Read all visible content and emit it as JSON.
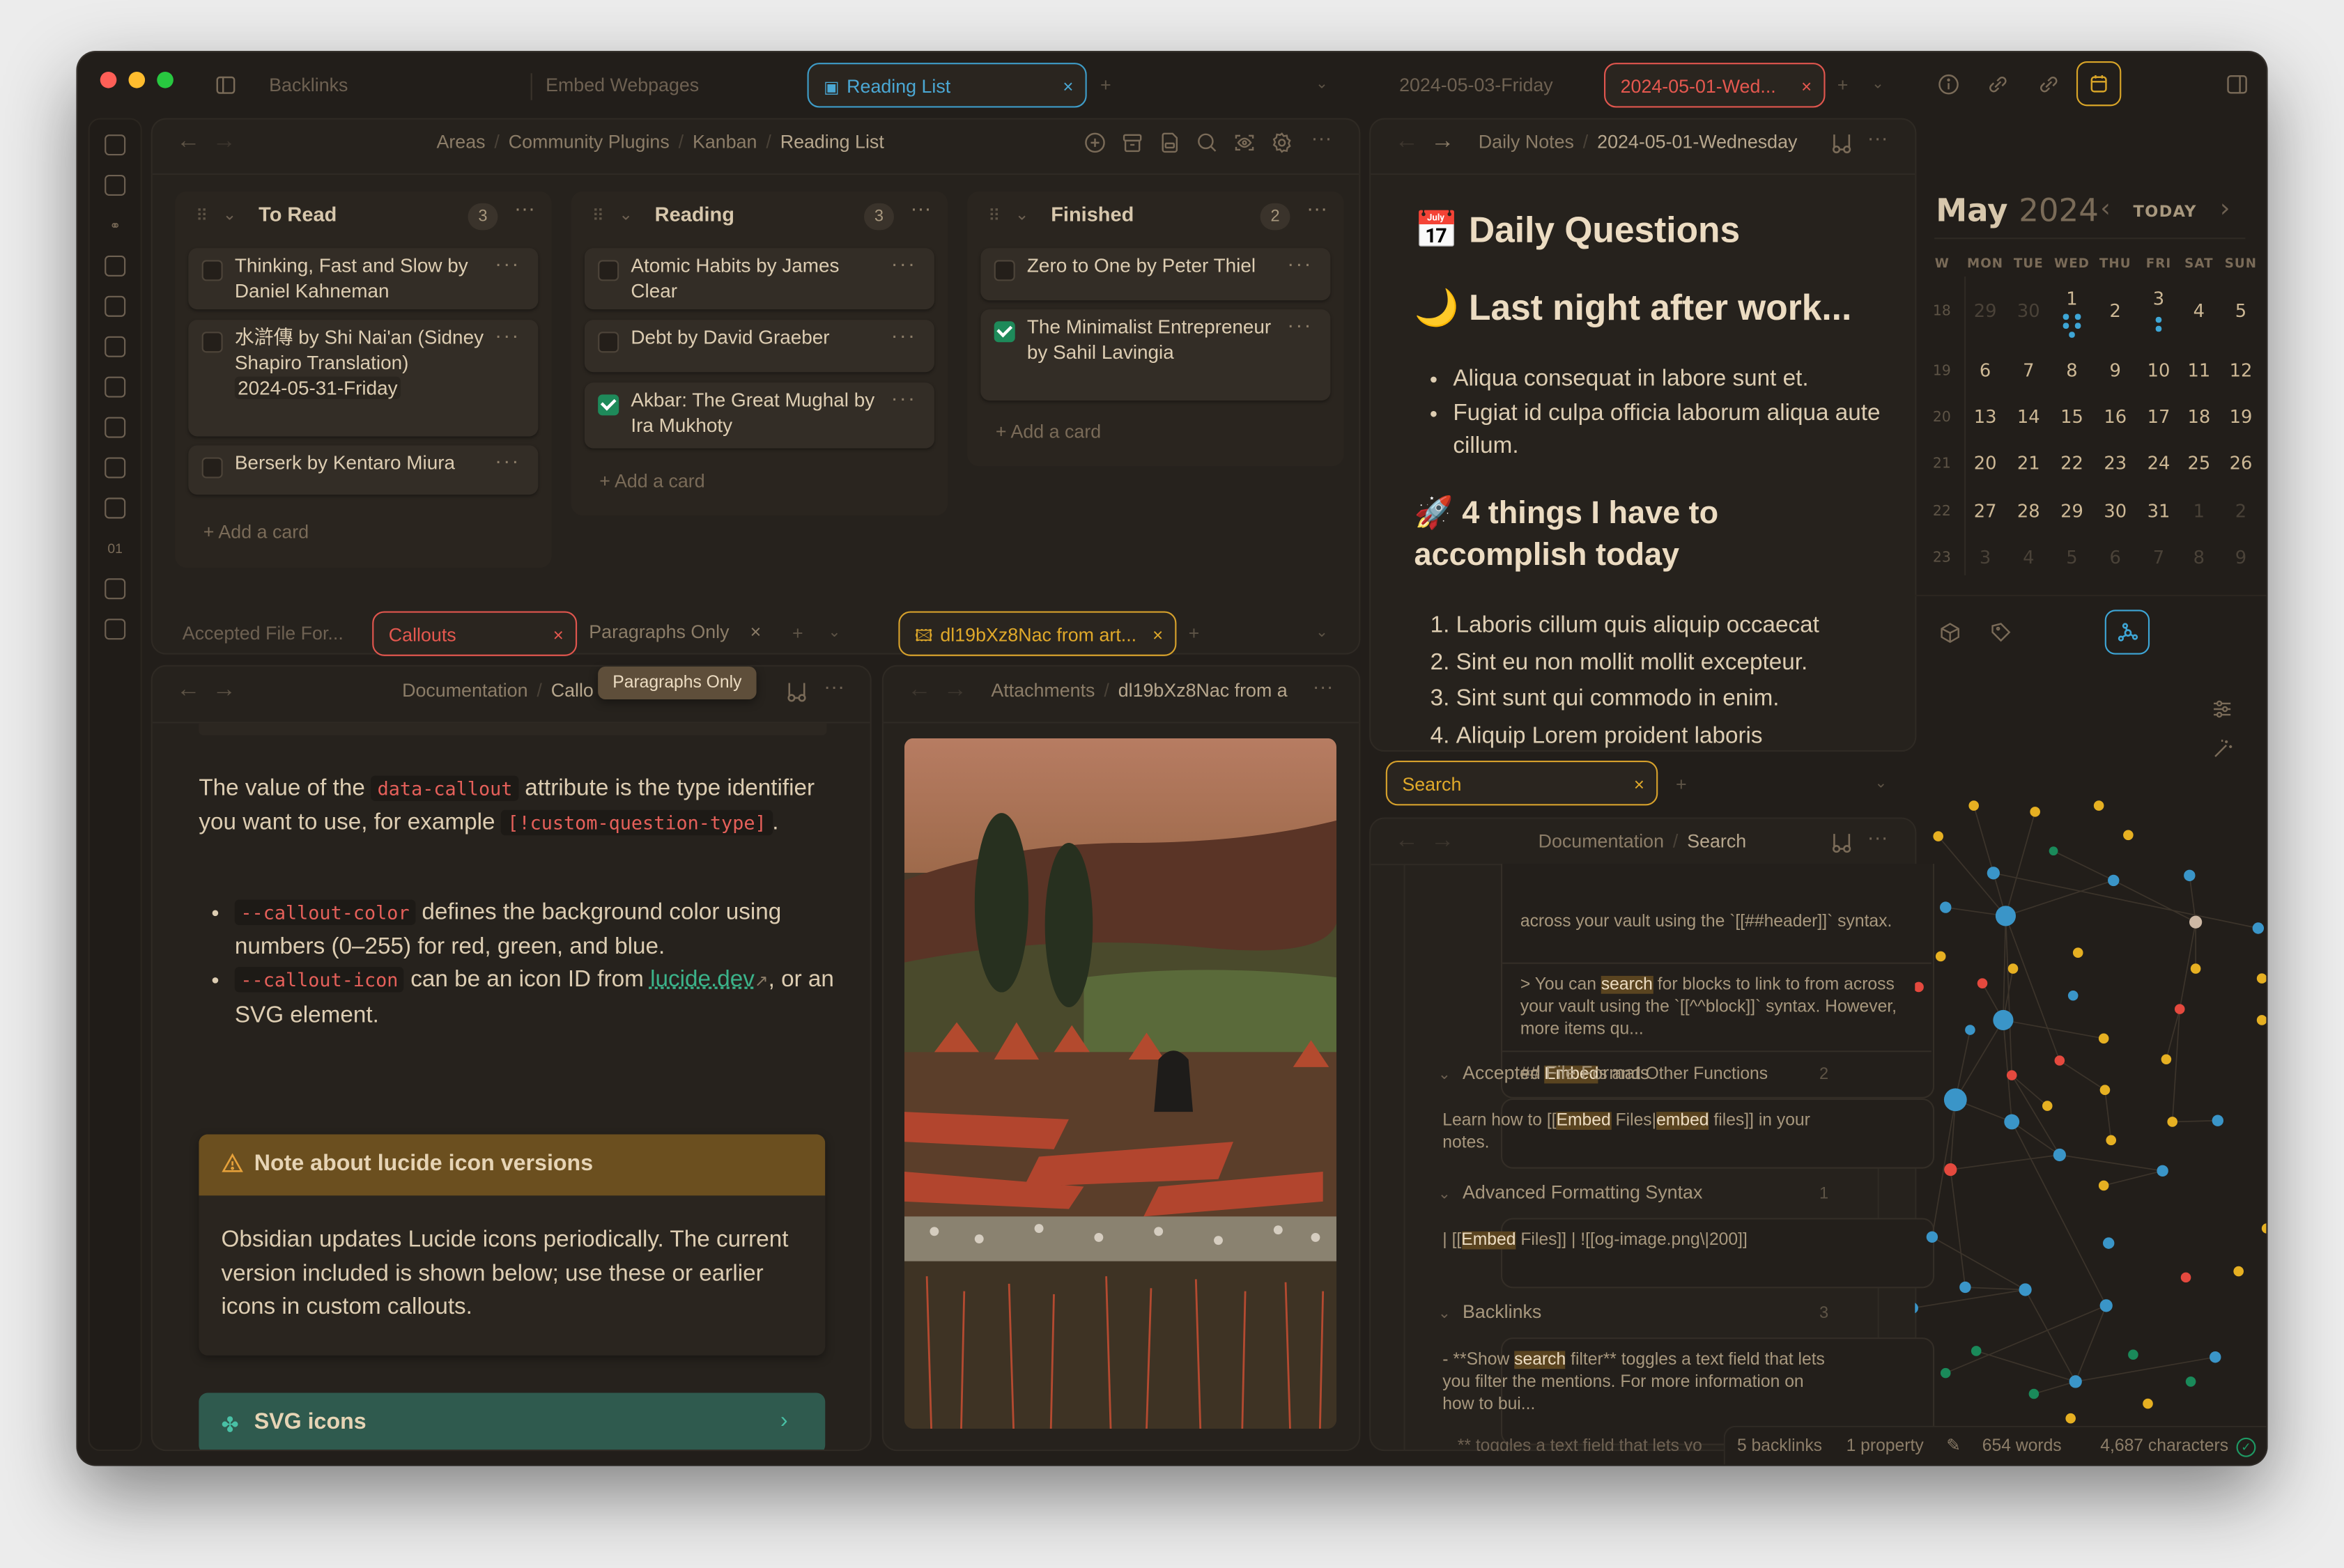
{
  "titlebar": {
    "tabs_left": [
      "Backlinks",
      "Embed Webpages",
      "Reading List"
    ],
    "active_tab_left": "Reading List",
    "tabs_right": [
      "2024-05-03-Friday",
      "2024-05-01-Wed..."
    ],
    "active_tab_right": "2024-05-01-Wed..."
  },
  "kanban": {
    "breadcrumb": [
      "Areas",
      "Community Plugins",
      "Kanban",
      "Reading List"
    ],
    "add_card_label": "+ Add a card",
    "columns": [
      {
        "title": "To Read",
        "count": "3",
        "cards": [
          {
            "text": "Thinking, Fast and Slow by Daniel Kahneman",
            "checked": false
          },
          {
            "text": "水滸傳 by Shi Nai'an (Sidney Shapiro Translation)",
            "date": "2024-05-31-Friday",
            "checked": false
          },
          {
            "text": "Berserk by Kentaro Miura",
            "checked": false
          }
        ]
      },
      {
        "title": "Reading",
        "count": "3",
        "cards": [
          {
            "text": "Atomic Habits by James Clear",
            "checked": false
          },
          {
            "text": "Debt by David Graeber",
            "checked": false
          },
          {
            "text": "Akbar: The Great Mughal by Ira Mukhoty",
            "checked": true
          }
        ]
      },
      {
        "title": "Finished",
        "count": "2",
        "cards": [
          {
            "text": "Zero to One by Peter Thiel",
            "checked": false
          },
          {
            "text": "The Minimalist Entrepreneur by Sahil Lavingia",
            "checked": true
          }
        ]
      }
    ]
  },
  "callouts_pane": {
    "tabs": [
      "Accepted File For...",
      "Callouts",
      "Paragraphs Only"
    ],
    "active_tab": "Callouts",
    "tooltip": "Paragraphs Only",
    "breadcrumb": [
      "Documentation",
      "Callo"
    ],
    "para": {
      "t1": "The value of the ",
      "code1": "data-callout",
      "t2": " attribute is the type identifier you want to use, for example ",
      "code2": "[!custom-question-type]",
      "t3": "."
    },
    "bullets": [
      {
        "code": "--callout-color",
        "text": " defines the background color using numbers (0–255) for red, green, and blue."
      },
      {
        "code": "--callout-icon",
        "text": " can be an icon ID from ",
        "link": "lucide.dev",
        "text2": ", or an SVG element."
      }
    ],
    "warning": {
      "title": "Note about lucide icon versions",
      "body": "Obsidian updates Lucide icons periodically. The current version included is shown below; use these or earlier icons in custom callouts.",
      "color": "#6b4f1f"
    },
    "svg_callout": {
      "title": "SVG icons",
      "color": "#2f5a4e"
    }
  },
  "image_pane": {
    "tab": "dl19bXz8Nac from art...",
    "breadcrumb": [
      "Attachments",
      "dl19bXz8Nac from a"
    ]
  },
  "daily_note": {
    "breadcrumb": [
      "Daily Notes",
      "2024-05-01-Wednesday"
    ],
    "h_daily": "Daily Questions",
    "h_last_night": "Last night after work...",
    "bullets": [
      "Aliqua consequat in labore sunt et.",
      "Fugiat id culpa officia laborum aliqua aute cillum."
    ],
    "h_things": "4 things I have to accomplish today",
    "numbered": [
      "Laboris cillum quis aliquip occaecat",
      "Sint eu non mollit mollit excepteur.",
      "Sint sunt qui commodo in enim.",
      "Aliquip Lorem proident laboris"
    ]
  },
  "search_pane": {
    "tab": "Search",
    "breadcrumb": [
      "Documentation",
      "Search"
    ],
    "results": {
      "cut_top": "across your vault using the `[[##header]]` syntax.",
      "r1": {
        "pre": "> You can ",
        "hl": "search",
        "post": " for blocks to link to from across your vault using the `[[^^block]]` syntax. However, more items qu..."
      },
      "r2": {
        "pre": "## ",
        "hl": "Embed",
        "post": "s and Other Functions"
      }
    },
    "groups": [
      {
        "title": "Accepted File Formats",
        "count": "2",
        "match": {
          "pre": "Learn how to [[",
          "hl": "Embed",
          "mid": " Files|",
          "hl2": "embed",
          "post": " files]] in your notes."
        }
      },
      {
        "title": "Advanced Formatting Syntax",
        "count": "1",
        "match": {
          "pre": "| [[",
          "hl": "Embed",
          "post": " Files]]    | ![[og-image.png\\|200]]"
        }
      },
      {
        "title": "Backlinks",
        "count": "3",
        "match": {
          "pre": "- **Show ",
          "hl": "search",
          "post": " filter** toggles a text field that lets you filter the mentions. For more information on how to bui..."
        }
      }
    ],
    "cut_bottom": "** toggles a text field that lets yo"
  },
  "calendar": {
    "month": "May",
    "year": "2024",
    "today_label": "TODAY",
    "weekday_headers": [
      "W",
      "MON",
      "TUE",
      "WED",
      "THU",
      "FRI",
      "SAT",
      "SUN"
    ],
    "weeks": [
      {
        "wk": "18",
        "days": [
          "29",
          "30",
          "1",
          "2",
          "3",
          "4",
          "5"
        ],
        "faded": [
          0,
          1
        ]
      },
      {
        "wk": "19",
        "days": [
          "6",
          "7",
          "8",
          "9",
          "10",
          "11",
          "12"
        ],
        "faded": []
      },
      {
        "wk": "20",
        "days": [
          "13",
          "14",
          "15",
          "16",
          "17",
          "18",
          "19"
        ],
        "faded": []
      },
      {
        "wk": "21",
        "days": [
          "20",
          "21",
          "22",
          "23",
          "24",
          "25",
          "26"
        ],
        "faded": []
      },
      {
        "wk": "22",
        "days": [
          "27",
          "28",
          "29",
          "30",
          "31",
          "1",
          "2"
        ],
        "faded": [
          5,
          6
        ]
      },
      {
        "wk": "23",
        "days": [
          "3",
          "4",
          "5",
          "6",
          "7",
          "8",
          "9"
        ],
        "faded": [
          0,
          1,
          2,
          3,
          4,
          5,
          6
        ]
      }
    ],
    "dots": {
      "1": 5,
      "3": 2
    },
    "dot_color": "#3ea6d6"
  },
  "graph": {
    "node_colors": {
      "blue": "#3a95c8",
      "yellow": "#e6b022",
      "red": "#e4493e",
      "green": "#1a8a5a",
      "beige": "#cdb8a4"
    }
  },
  "statusbar": {
    "backlinks": "5 backlinks",
    "properties": "1 property",
    "words": "654 words",
    "characters": "4,687 characters"
  },
  "colors": {
    "accent_blue": "#3ea6d6",
    "accent_red": "#e5584f",
    "accent_yellow": "#e0a92a",
    "check_green": "#1e8a5a",
    "link_green": "#3bb38a"
  }
}
